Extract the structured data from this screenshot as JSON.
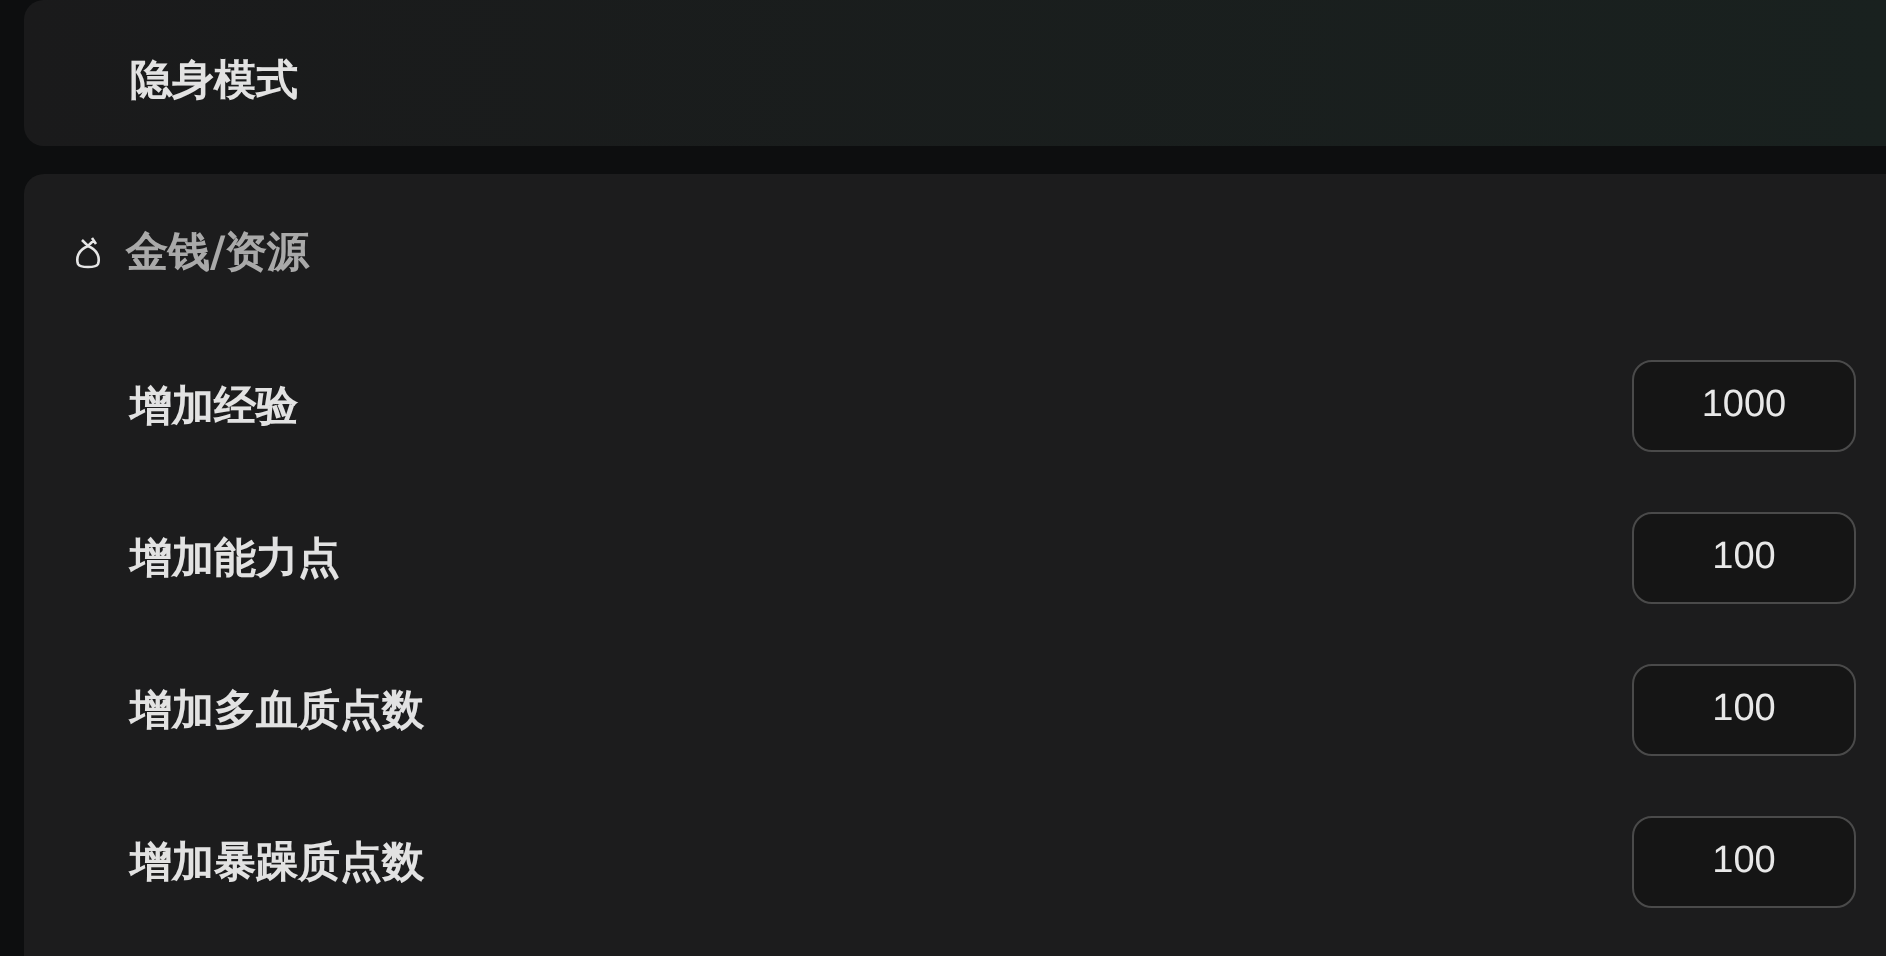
{
  "top_card": {
    "label": "隐身模式"
  },
  "section": {
    "title": "金钱/资源",
    "rows": [
      {
        "label": "增加经验",
        "value": "1000"
      },
      {
        "label": "增加能力点",
        "value": "100"
      },
      {
        "label": "增加多血质点数",
        "value": "100"
      },
      {
        "label": "增加暴躁质点数",
        "value": "100"
      }
    ]
  }
}
